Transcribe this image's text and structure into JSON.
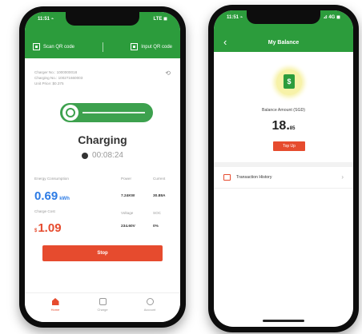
{
  "colors": {
    "brand_green": "#2c9c3c",
    "accent_red": "#e64b2e",
    "energy_blue": "#2c7be5"
  },
  "phone1": {
    "status": {
      "time": "11:51 ⌁",
      "signal": "LTE ◼"
    },
    "scan_qr": "Scan QR code",
    "input_qr": "Input QR code",
    "info": {
      "charger_no": "Charger No.: 1000000018",
      "charging_no": "Charging No.: 100271660003",
      "unit_price": "Unit Price: $0.375"
    },
    "title": "Charging",
    "timer": "00:08:24",
    "energy_label": "Energy Consumption",
    "energy_value": "0.69",
    "energy_unit": "kWh",
    "cost_label": "Charge Cost",
    "cost_currency": "$",
    "cost_value": "1.09",
    "power_label": "Power",
    "power_value": "7.24KW",
    "current_label": "Current",
    "current_value": "30.88A",
    "voltage_label": "Voltage",
    "voltage_value": "234.60V",
    "soc_label": "SOC",
    "soc_value": "0%",
    "stop": "Stop",
    "tabs": {
      "home": "Home",
      "charge": "Charge",
      "account": "Account"
    }
  },
  "phone2": {
    "status": {
      "time": "11:51 ⌁",
      "signal": "⊿ 4G ◼"
    },
    "title": "My Balance",
    "wallet_symbol": "$",
    "balance_label": "Balance Amount (SGD)",
    "balance_int": "18.",
    "balance_dec": "85",
    "topup": "Top Up",
    "transaction_history": "Transaction History",
    "chevron": "›"
  }
}
